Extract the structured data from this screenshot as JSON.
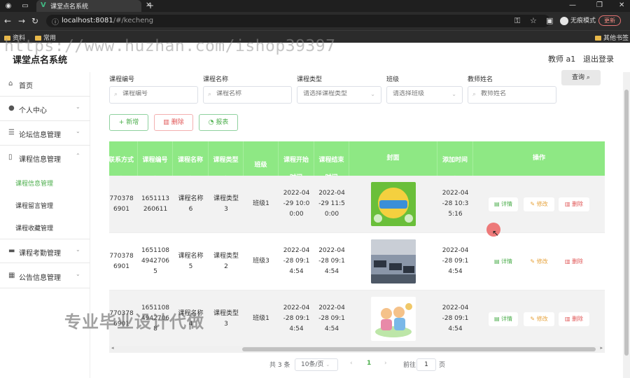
{
  "browser": {
    "tab_title": "课堂点名系统",
    "url_host": "localhost:8081",
    "url_path": "/#/kecheng",
    "profile_label": "无痕模式",
    "update_label": "更新",
    "bookmarks": [
      "资料",
      "常用"
    ],
    "bookmark_right": "其他书签"
  },
  "header": {
    "title": "课堂点名系统",
    "user": "教师 a1",
    "logout": "退出登录",
    "watermark": "https://www.huzhan.com/ishop39397"
  },
  "sidebar": {
    "items": [
      {
        "label": "首页",
        "icon": "home-icon"
      },
      {
        "label": "个人中心",
        "icon": "user-icon"
      },
      {
        "label": "论坛信息管理",
        "icon": "list-icon"
      },
      {
        "label": "课程信息管理",
        "icon": "phone-icon"
      },
      {
        "label": "课程考勤管理",
        "icon": "inbox-icon"
      },
      {
        "label": "公告信息管理",
        "icon": "grid-icon"
      }
    ],
    "subitems": [
      "课程信息管理",
      "课程留言管理",
      "课程收藏管理"
    ]
  },
  "search": {
    "fields": [
      {
        "label": "课程编号",
        "placeholder": "课程编号"
      },
      {
        "label": "课程名称",
        "placeholder": "课程名称"
      },
      {
        "label": "课程类型",
        "placeholder": "请选择课程类型"
      },
      {
        "label": "班级",
        "placeholder": "请选择班级"
      },
      {
        "label": "教师姓名",
        "placeholder": "教师姓名"
      }
    ],
    "query_label": "查询"
  },
  "actions": {
    "add": "新增",
    "delete": "删除",
    "report": "报表"
  },
  "table": {
    "headers": [
      [
        "联系方式",
        "▲"
      ],
      [
        "课程编号",
        "▲"
      ],
      [
        "课程名称",
        "▲"
      ],
      [
        "课程类型",
        "▲"
      ],
      [
        "班级",
        "▲"
      ],
      [
        "课程开始",
        "时间"
      ],
      [
        "课程结束",
        "时间"
      ],
      [
        "封面",
        ""
      ],
      [
        "添加时间",
        "▲"
      ],
      [
        "操作",
        ""
      ]
    ],
    "rows": [
      {
        "contact": [
          "770378",
          "6901"
        ],
        "code": [
          "1651113",
          "260611"
        ],
        "name": [
          "课程名称",
          "6"
        ],
        "type": [
          "课程类型",
          "3"
        ],
        "class": "班级1",
        "start": [
          "2022-04",
          "-29 10:0",
          "0:00"
        ],
        "end": [
          "2022-04",
          "-29 11:5",
          "0:00"
        ],
        "added": [
          "2022-04",
          "-28 10:3",
          "5:16"
        ],
        "cover_color": "#6abf3a"
      },
      {
        "contact": [
          "770378",
          "6901"
        ],
        "code": [
          "1651108",
          "4942706",
          "5"
        ],
        "name": [
          "课程名称",
          "5"
        ],
        "type": [
          "课程类型",
          "2"
        ],
        "class": "班级3",
        "start": [
          "2022-04",
          "-28 09:1",
          "4:54"
        ],
        "end": [
          "2022-04",
          "-28 09:1",
          "4:54"
        ],
        "added": [
          "2022-04",
          "-28 09:1",
          "4:54"
        ],
        "cover_color": "#5b6e86"
      },
      {
        "contact": [
          "770378",
          "6901"
        ],
        "code": [
          "1651108",
          "4942706",
          "8"
        ],
        "name": [
          "课程名称",
          "4"
        ],
        "type": [
          "课程类型",
          "3"
        ],
        "class": "班级1",
        "start": [
          "2022-04",
          "-28 09:1",
          "4:54"
        ],
        "end": [
          "2022-04",
          "-28 09:1",
          "4:54"
        ],
        "added": [
          "2022-04",
          "-28 09:1",
          "4:54"
        ],
        "cover_color": "#f0c868"
      }
    ],
    "ops": {
      "detail": "详情",
      "edit": "修改",
      "remove": "删除"
    }
  },
  "pagination": {
    "total": "共 3 条",
    "page_size": "10条/页",
    "current": "1",
    "goto": "前往",
    "goto_value": "1",
    "page_suffix": "页"
  },
  "overlay": "专业毕业设计代做",
  "colors": {
    "accent": "#4cae4c",
    "header_green": "#8ee884",
    "danger": "#e05555",
    "warning": "#e6a23c"
  }
}
